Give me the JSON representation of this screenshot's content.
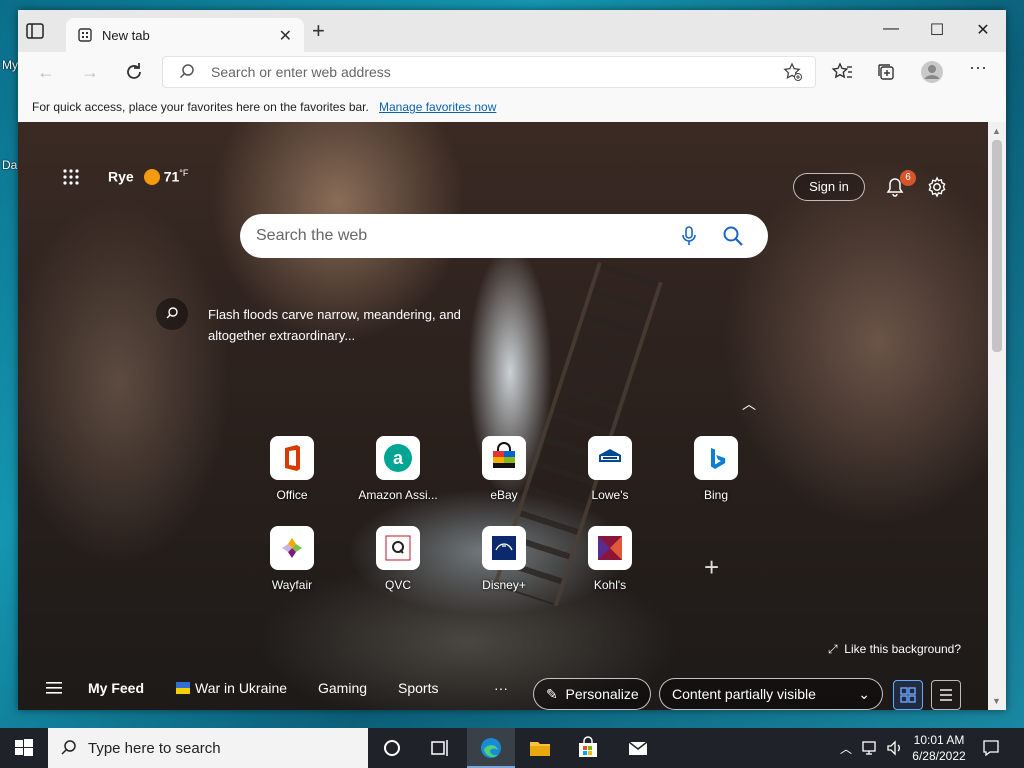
{
  "desktop": {
    "icon1_label": "My",
    "icon2_label": "Da"
  },
  "window": {
    "tab_title": "New tab",
    "close_tab": "✕",
    "new_tab": "+",
    "minimize": "—",
    "maximize": "☐",
    "close": "✕"
  },
  "navbar": {
    "address_placeholder": "Search or enter web address"
  },
  "favbar": {
    "message": "For quick access, place your favorites here on the favorites bar.",
    "link": "Manage favorites now"
  },
  "page": {
    "weather": {
      "location": "Rye",
      "temp": "71",
      "unit": "°F"
    },
    "sign_in": "Sign in",
    "notifications_count": "6",
    "search_placeholder": "Search the web",
    "fact": "Flash floods carve narrow, meandering, and altogether extraordinary...",
    "like_background": "Like this background?",
    "quick_links": [
      {
        "label": "Office",
        "color": "#d83b01"
      },
      {
        "label": "Amazon Assi...",
        "color": "#009f8c"
      },
      {
        "label": "eBay",
        "color": "#e53238"
      },
      {
        "label": "Lowe's",
        "color": "#004990"
      },
      {
        "label": "Bing",
        "color": "#0a7fd4"
      },
      {
        "label": "Wayfair",
        "color": "#7f187f"
      },
      {
        "label": "QVC",
        "color": "#c8102e"
      },
      {
        "label": "Disney+",
        "color": "#0b2a6e"
      },
      {
        "label": "Kohl's",
        "color": "#8a1538"
      }
    ],
    "feed": {
      "my_feed": "My Feed",
      "war_in_ukraine": "War in Ukraine",
      "gaming": "Gaming",
      "sports": "Sports",
      "more": "···",
      "personalize": "Personalize",
      "content_visibility": "Content partially visible"
    }
  },
  "taskbar": {
    "search_placeholder": "Type here to search",
    "time": "10:01 AM",
    "date": "6/28/2022"
  }
}
